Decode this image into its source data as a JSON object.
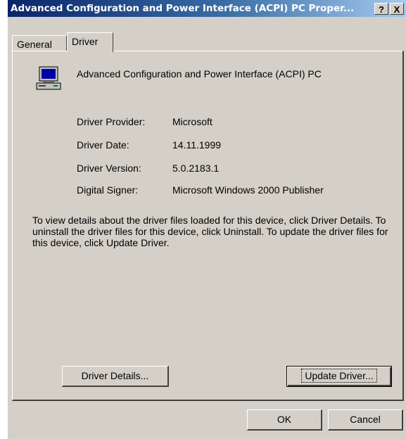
{
  "window": {
    "title": "Advanced Configuration and Power Interface (ACPI) PC Proper...",
    "help_label": "?",
    "close_label": "X"
  },
  "tabs": [
    {
      "label": "General"
    },
    {
      "label": "Driver"
    }
  ],
  "device": {
    "icon": "computer-icon",
    "name": "Advanced Configuration and Power Interface (ACPI) PC"
  },
  "info": [
    {
      "label": "Driver Provider:",
      "value": "Microsoft"
    },
    {
      "label": "Driver Date:",
      "value": "14.11.1999"
    },
    {
      "label": "Driver Version:",
      "value": "5.0.2183.1"
    },
    {
      "label": "Digital Signer:",
      "value": "Microsoft Windows 2000 Publisher"
    }
  ],
  "description": "To view details about the driver files loaded for this device, click Driver Details. To uninstall the driver files for this device, click Uninstall. To update the driver files for this device, click Update Driver.",
  "buttons": {
    "driver_details": "Driver Details...",
    "update_driver": "Update Driver...",
    "ok": "OK",
    "cancel": "Cancel"
  },
  "colors": {
    "face": "#d4d0c8",
    "title_start": "#0a246a",
    "title_end": "#a6caf0"
  }
}
